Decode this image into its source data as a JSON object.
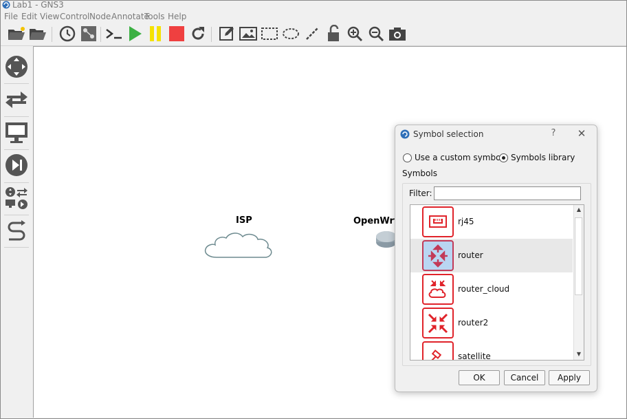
{
  "window": {
    "title": "Lab1 - GNS3"
  },
  "menu": [
    "File",
    "Edit",
    "View",
    "Control",
    "Node",
    "Annotate",
    "Tools",
    "Help"
  ],
  "toolbar": {
    "icons": [
      "open-project-icon",
      "open-folder-icon",
      "history-icon",
      "snapshot-icon",
      "console-icon",
      "start-icon",
      "suspend-icon",
      "stop-icon",
      "reload-icon",
      "add-note-icon",
      "insert-image-icon",
      "draw-rectangle-icon",
      "draw-ellipse-icon",
      "draw-line-icon",
      "lock-icon",
      "zoom-in-icon",
      "zoom-out-icon",
      "screenshot-icon"
    ]
  },
  "dock": {
    "icons": [
      "routers-icon",
      "switches-icon",
      "end-devices-icon",
      "security-devices-icon",
      "all-devices-icon",
      "add-link-icon"
    ]
  },
  "canvas": {
    "nodes": [
      {
        "label": "ISP",
        "icon": "cloud-icon"
      },
      {
        "label": "OpenWrt1",
        "icon": "router-device-icon"
      }
    ]
  },
  "dialog": {
    "title": "Symbol selection",
    "help_label": "?",
    "close_label": "✕",
    "option_custom": "Use a custom symbol",
    "option_library": "Symbols library",
    "selected_option": "Symbols library",
    "group_label": "Symbols",
    "filter_label": "Filter:",
    "filter_value": "",
    "symbols": [
      {
        "name": "rj45",
        "icon": "rj45-icon"
      },
      {
        "name": "router",
        "icon": "router-symbol-icon",
        "selected": true
      },
      {
        "name": "router_cloud",
        "icon": "router-cloud-icon"
      },
      {
        "name": "router2",
        "icon": "router2-icon"
      },
      {
        "name": "satellite",
        "icon": "satellite-icon"
      }
    ],
    "scroll_up": "▲",
    "scroll_down": "▼",
    "buttons": {
      "ok": "OK",
      "cancel": "Cancel",
      "apply": "Apply"
    }
  },
  "colors": {
    "symbol_red": "#e0232a",
    "selected_symbol_bg": "#b9d6f2",
    "play_green": "#3cb043",
    "pause_yellow": "#f5e200",
    "stop_red": "#ef4040"
  }
}
